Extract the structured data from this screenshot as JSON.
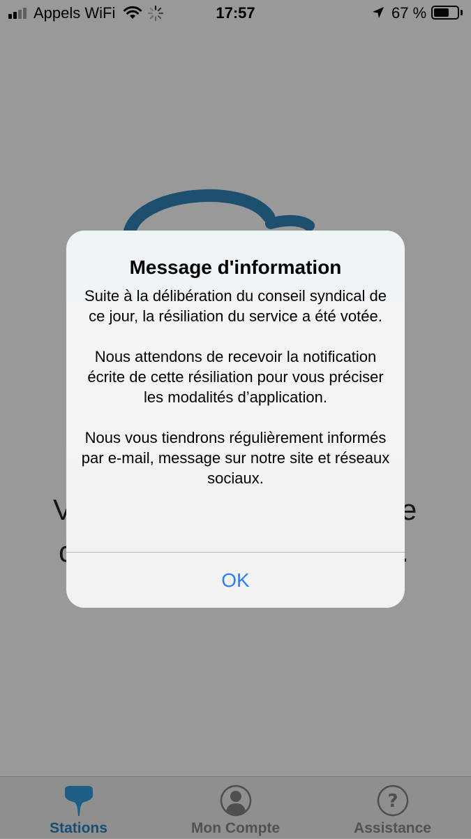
{
  "status_bar": {
    "carrier": "Appels WiFi",
    "time": "17:57",
    "battery_percent": "67 %",
    "battery_level": 0.67,
    "signal_bars_filled": 2,
    "signal_bars_total": 4
  },
  "background": {
    "partial_text_lines": [
      "V",
      "e",
      "c",
      "."
    ]
  },
  "alert": {
    "title": "Message d'information",
    "paragraphs": [
      "Suite à la délibération du conseil syndical de ce jour, la résiliation du service a été votée.",
      "Nous attendons de recevoir la notification écrite de cette résiliation pour vous préciser les modalités d’application.",
      "Nous vous tiendrons régulièrement informés par e-mail, message sur notre site et réseaux sociaux."
    ],
    "ok_label": "OK"
  },
  "tab_bar": {
    "tabs": [
      {
        "label": "Stations",
        "icon": "stations-icon",
        "active": true
      },
      {
        "label": "Mon Compte",
        "icon": "account-icon",
        "active": false
      },
      {
        "label": "Assistance",
        "icon": "help-icon",
        "active": false
      }
    ]
  },
  "colors": {
    "dim_background": "#999999",
    "accent": "#2f7df6",
    "brand": "#1d5d86"
  }
}
